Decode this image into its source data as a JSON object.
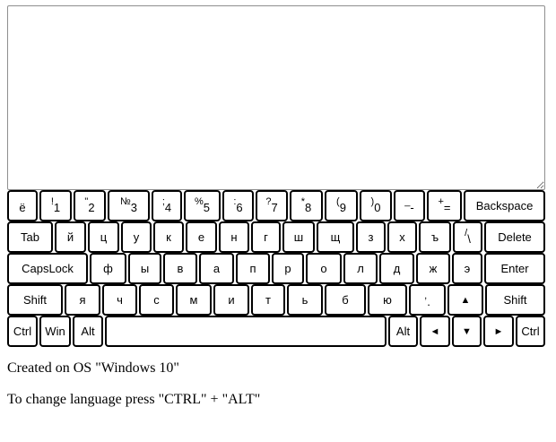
{
  "editor": {
    "value": ""
  },
  "keyboard": {
    "rows": [
      [
        {
          "name": "key-yo",
          "main": "ё"
        },
        {
          "name": "key-1",
          "shift": "!",
          "main": "1"
        },
        {
          "name": "key-2",
          "shift": "\"",
          "main": "2"
        },
        {
          "name": "key-3",
          "shift": "№",
          "main": "3"
        },
        {
          "name": "key-4",
          "shift": ";",
          "main": "4"
        },
        {
          "name": "key-5",
          "shift": "%",
          "main": "5"
        },
        {
          "name": "key-6",
          "shift": ":",
          "main": "6"
        },
        {
          "name": "key-7",
          "shift": "?",
          "main": "7"
        },
        {
          "name": "key-8",
          "shift": "*",
          "main": "8"
        },
        {
          "name": "key-9",
          "shift": "(",
          "main": "9"
        },
        {
          "name": "key-0",
          "shift": ")",
          "main": "0"
        },
        {
          "name": "key-minus",
          "shift": "_",
          "main": "-"
        },
        {
          "name": "key-equals",
          "shift": "+",
          "main": "="
        },
        {
          "name": "key-backspace",
          "label": "Backspace"
        }
      ],
      [
        {
          "name": "key-tab",
          "label": "Tab"
        },
        {
          "name": "key-y-short",
          "label": "й"
        },
        {
          "name": "key-ts",
          "label": "ц"
        },
        {
          "name": "key-u",
          "label": "у"
        },
        {
          "name": "key-k",
          "label": "к"
        },
        {
          "name": "key-e",
          "label": "е"
        },
        {
          "name": "key-n",
          "label": "н"
        },
        {
          "name": "key-g",
          "label": "г"
        },
        {
          "name": "key-sh",
          "label": "ш"
        },
        {
          "name": "key-shch",
          "label": "щ"
        },
        {
          "name": "key-z",
          "label": "з"
        },
        {
          "name": "key-kh",
          "label": "х"
        },
        {
          "name": "key-hard-sign",
          "label": "ъ"
        },
        {
          "name": "key-slash",
          "shift": "/",
          "main": "\\"
        },
        {
          "name": "key-delete",
          "label": "Delete"
        }
      ],
      [
        {
          "name": "key-capslock",
          "label": "CapsLock"
        },
        {
          "name": "key-f",
          "label": "ф"
        },
        {
          "name": "key-y",
          "label": "ы"
        },
        {
          "name": "key-v",
          "label": "в"
        },
        {
          "name": "key-a",
          "label": "а"
        },
        {
          "name": "key-p",
          "label": "п"
        },
        {
          "name": "key-r",
          "label": "р"
        },
        {
          "name": "key-o",
          "label": "о"
        },
        {
          "name": "key-l",
          "label": "л"
        },
        {
          "name": "key-d",
          "label": "д"
        },
        {
          "name": "key-zh",
          "label": "ж"
        },
        {
          "name": "key-e-rev",
          "label": "э"
        },
        {
          "name": "key-enter",
          "label": "Enter"
        }
      ],
      [
        {
          "name": "key-shift-left",
          "label": "Shift"
        },
        {
          "name": "key-ya",
          "label": "я"
        },
        {
          "name": "key-ch",
          "label": "ч"
        },
        {
          "name": "key-s",
          "label": "с"
        },
        {
          "name": "key-m",
          "label": "м"
        },
        {
          "name": "key-i",
          "label": "и"
        },
        {
          "name": "key-t",
          "label": "т"
        },
        {
          "name": "key-soft-sign",
          "label": "ь"
        },
        {
          "name": "key-b",
          "label": "б"
        },
        {
          "name": "key-yu",
          "label": "ю"
        },
        {
          "name": "key-period",
          "shift": ",",
          "main": "."
        },
        {
          "name": "key-arrow-up",
          "label": "▲",
          "arrow": true
        },
        {
          "name": "key-shift-right",
          "label": "Shift"
        }
      ],
      [
        {
          "name": "key-ctrl-left",
          "label": "Ctrl"
        },
        {
          "name": "key-win",
          "label": "Win"
        },
        {
          "name": "key-alt-left",
          "label": "Alt"
        },
        {
          "name": "key-space",
          "label": ""
        },
        {
          "name": "key-alt-right",
          "label": "Alt"
        },
        {
          "name": "key-arrow-left",
          "label": "◄",
          "arrow": true
        },
        {
          "name": "key-arrow-down",
          "label": "▼",
          "arrow": true
        },
        {
          "name": "key-arrow-right",
          "label": "►",
          "arrow": true
        },
        {
          "name": "key-ctrl-right",
          "label": "Ctrl"
        }
      ]
    ]
  },
  "footer": {
    "os_text": "Created on OS \"Windows 10\"",
    "hint_text": "To change language press \"CTRL\" + \"ALT\""
  }
}
